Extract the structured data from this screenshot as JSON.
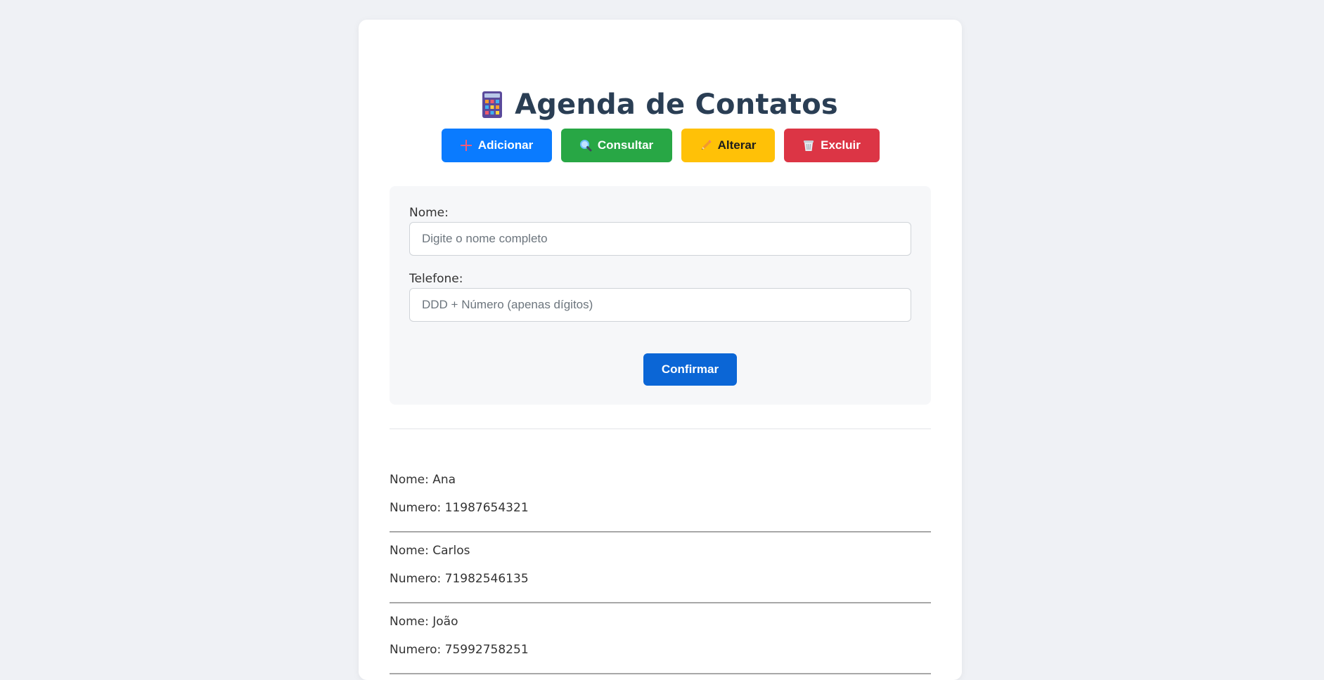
{
  "header": {
    "title": "Agenda de Contatos",
    "icon": "abacus-icon"
  },
  "actions": {
    "add_label": "Adicionar",
    "query_label": "Consultar",
    "edit_label": "Alterar",
    "delete_label": "Excluir"
  },
  "form": {
    "name_label": "Nome:",
    "name_placeholder": "Digite o nome completo",
    "name_value": "",
    "phone_label": "Telefone:",
    "phone_placeholder": "DDD + Número (apenas dígitos)",
    "phone_value": "",
    "confirm_label": "Confirmar"
  },
  "contacts": [
    {
      "name": "Nome: Ana",
      "number": "Numero: 11987654321"
    },
    {
      "name": "Nome: Carlos",
      "number": "Numero: 71982546135"
    },
    {
      "name": "Nome: João",
      "number": "Numero: 75992758251"
    }
  ],
  "colors": {
    "add": "#0a7bff",
    "query": "#28a745",
    "edit": "#ffc107",
    "delete": "#dc3545",
    "confirm": "#0b66d6",
    "title": "#2a3e54"
  }
}
